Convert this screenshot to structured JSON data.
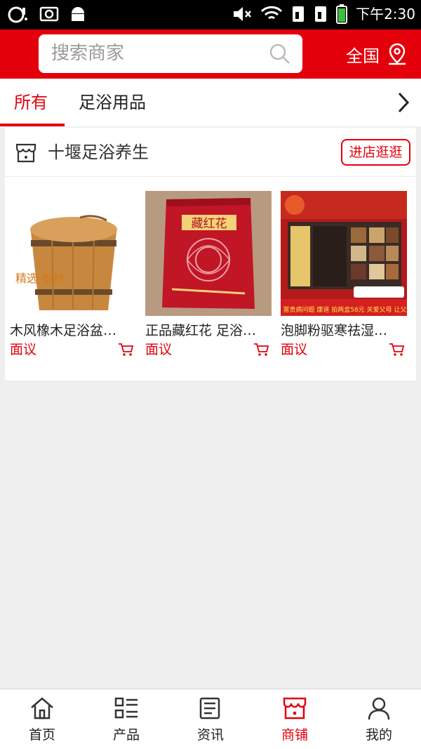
{
  "status_bar": {
    "time": "下午2:30",
    "icons": [
      "headset-icon",
      "screenshot-icon",
      "android-icon",
      "mute-icon",
      "wifi-icon",
      "sim1-icon",
      "sim2-icon",
      "battery-icon"
    ]
  },
  "header": {
    "search_placeholder": "搜索商家",
    "region_label": "全国",
    "accent_color": "#e4000b"
  },
  "category_tabs": [
    {
      "label": "所有",
      "active": true
    },
    {
      "label": "足浴用品",
      "active": false
    }
  ],
  "shop": {
    "name": "十堰足浴养生",
    "enter_label": "进店逛逛",
    "products": [
      {
        "title": "木风橡木足浴盆…",
        "price": "面议",
        "image_text": "精选 板材"
      },
      {
        "title": "正品藏红花 足浴…",
        "price": "面议",
        "image_text": "藏红花"
      },
      {
        "title": "泡脚粉驱寒祛湿…",
        "price": "面议",
        "image_text": "中老年三高 富贵病问题 康道 拍两盒58元 关爱父母 让父母远离痛苦"
      }
    ]
  },
  "bottom_nav": [
    {
      "label": "首页",
      "icon": "home-icon",
      "active": false
    },
    {
      "label": "产品",
      "icon": "product-list-icon",
      "active": false
    },
    {
      "label": "资讯",
      "icon": "news-icon",
      "active": false
    },
    {
      "label": "商铺",
      "icon": "shop-icon",
      "active": true
    },
    {
      "label": "我的",
      "icon": "user-icon",
      "active": false
    }
  ]
}
